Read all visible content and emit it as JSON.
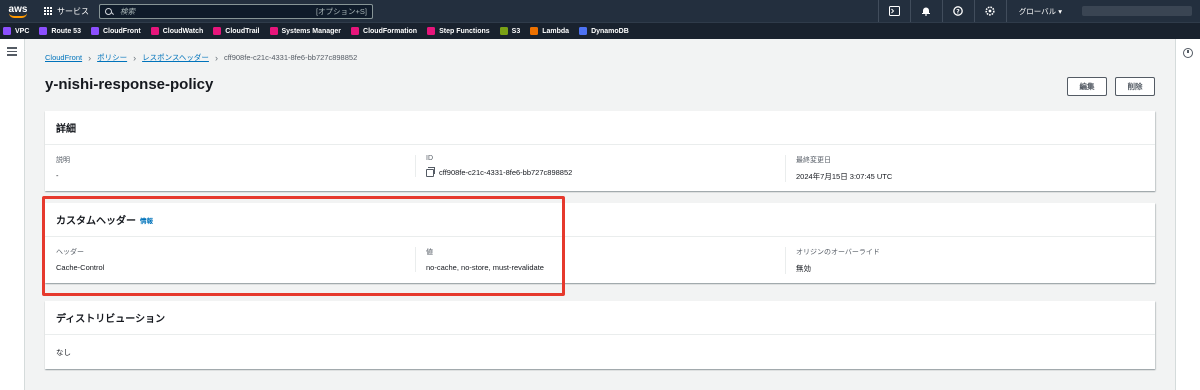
{
  "topnav": {
    "logo": "aws",
    "services_label": "サービス",
    "search_placeholder": "検索",
    "search_hint": "[オプション+S]",
    "icons": [
      "terminal-icon",
      "bell-icon",
      "help-icon",
      "gear-icon"
    ],
    "region_label": "グローバル ▾"
  },
  "favorites": [
    {
      "label": "VPC",
      "color": "#8c4fff"
    },
    {
      "label": "Route 53",
      "color": "#8c4fff"
    },
    {
      "label": "CloudFront",
      "color": "#8c4fff"
    },
    {
      "label": "CloudWatch",
      "color": "#e7157b"
    },
    {
      "label": "CloudTrail",
      "color": "#e7157b"
    },
    {
      "label": "Systems Manager",
      "color": "#e7157b"
    },
    {
      "label": "CloudFormation",
      "color": "#e7157b"
    },
    {
      "label": "Step Functions",
      "color": "#e7157b"
    },
    {
      "label": "S3",
      "color": "#7aa116"
    },
    {
      "label": "Lambda",
      "color": "#ed7100"
    },
    {
      "label": "DynamoDB",
      "color": "#4d72f3"
    }
  ],
  "breadcrumb": {
    "items": [
      "CloudFront",
      "ポリシー",
      "レスポンスヘッダー"
    ],
    "current": "cff908fe-c21c-4331-8fe6-bb727c898852"
  },
  "page": {
    "title": "y-nishi-response-policy",
    "edit_label": "編集",
    "delete_label": "削除"
  },
  "details": {
    "heading": "詳細",
    "description_label": "説明",
    "description_value": "-",
    "id_label": "ID",
    "id_value": "cff908fe-c21c-4331-8fe6-bb727c898852",
    "modified_label": "最終変更日",
    "modified_value": "2024年7月15日 3:07:45 UTC"
  },
  "custom_headers": {
    "heading": "カスタムヘッダー",
    "info_link": "情報",
    "header_label": "ヘッダー",
    "header_value": "Cache-Control",
    "value_label": "値",
    "value_value": "no-cache, no-store, must-revalidate",
    "override_label": "オリジンのオーバーライド",
    "override_value": "無効"
  },
  "distributions": {
    "heading": "ディストリビューション",
    "value": "なし"
  },
  "colors": {
    "nav_bg": "#232f3e",
    "link": "#0073bb",
    "highlight": "#e6392d"
  }
}
